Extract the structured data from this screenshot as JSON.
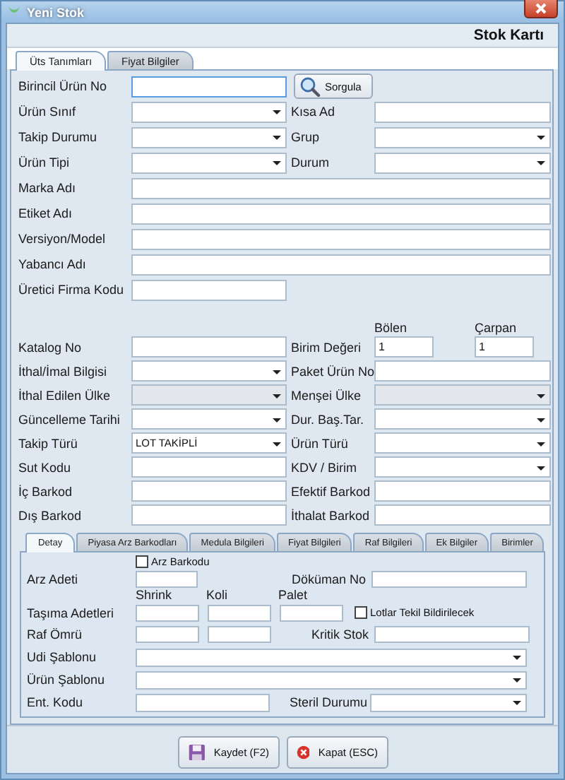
{
  "window": {
    "title": "Yeni Stok"
  },
  "header": {
    "title": "Stok Kartı"
  },
  "tabs": [
    {
      "label": "Üts Tanımları",
      "selected": true
    },
    {
      "label": "Fiyat Bilgiler",
      "selected": false
    }
  ],
  "form": {
    "search_button": "Sorgula",
    "rows": [
      {
        "kind": "search",
        "fields": [
          {
            "label": "Birincil Ürün No",
            "kind": "text",
            "disabled": false
          }
        ]
      },
      {
        "kind": "pair",
        "fields": [
          {
            "label": "Ürün Sınıf",
            "kind": "select",
            "disabled": false
          },
          {
            "label": "Kısa Ad",
            "kind": "text",
            "disabled": false
          }
        ]
      },
      {
        "kind": "pair",
        "fields": [
          {
            "label": "Takip Durumu",
            "kind": "select",
            "disabled": false
          },
          {
            "label": "Grup",
            "kind": "select",
            "disabled": false
          }
        ]
      },
      {
        "kind": "pair",
        "fields": [
          {
            "label": "Ürün Tipi",
            "kind": "select",
            "disabled": false
          },
          {
            "label": "Durum",
            "kind": "select",
            "disabled": false
          }
        ]
      },
      {
        "kind": "wide",
        "fields": [
          {
            "label": "Marka Adı",
            "kind": "text",
            "disabled": false
          }
        ]
      },
      {
        "kind": "wide",
        "fields": [
          {
            "label": "Etiket Adı",
            "kind": "text",
            "disabled": false
          }
        ]
      },
      {
        "kind": "wide",
        "fields": [
          {
            "label": "Versiyon/Model",
            "kind": "text",
            "disabled": false
          }
        ]
      },
      {
        "kind": "wide",
        "fields": [
          {
            "label": "Yabancı Adı",
            "kind": "text",
            "disabled": false
          }
        ]
      },
      {
        "kind": "single",
        "fields": [
          {
            "label": "Üretici Firma Kodu",
            "kind": "text",
            "disabled": false
          }
        ]
      },
      {
        "kind": "ratio",
        "fields": [
          {
            "label": "Katalog No",
            "kind": "text",
            "disabled": false
          }
        ],
        "ratio": {
          "label": "Birim Değeri",
          "parts": [
            {
              "heading": "Bölen",
              "value": "1"
            },
            {
              "heading": "Çarpan",
              "value": "1"
            }
          ]
        }
      },
      {
        "kind": "pair",
        "fields": [
          {
            "label": "İthal/İmal Bilgisi",
            "kind": "select",
            "disabled": false
          },
          {
            "label": "Paket Ürün No",
            "kind": "text",
            "disabled": false
          }
        ]
      },
      {
        "kind": "pair",
        "fields": [
          {
            "label": "İthal Edilen Ülke",
            "kind": "select",
            "disabled": true
          },
          {
            "label": "Menşei Ülke",
            "kind": "select",
            "disabled": true
          }
        ]
      },
      {
        "kind": "pair",
        "fields": [
          {
            "label": "Güncelleme Tarihi",
            "kind": "select",
            "disabled": false
          },
          {
            "label": "Dur. Baş.Tar.",
            "kind": "select",
            "disabled": false
          }
        ]
      },
      {
        "kind": "pair",
        "fields": [
          {
            "label": "Takip Türü",
            "kind": "select",
            "value": "LOT TAKİPLİ",
            "disabled": false
          },
          {
            "label": "Ürün Türü",
            "kind": "select",
            "disabled": false
          }
        ]
      },
      {
        "kind": "pair",
        "fields": [
          {
            "label": "Sut Kodu",
            "kind": "text",
            "disabled": false
          },
          {
            "label": "KDV / Birim",
            "kind": "select",
            "disabled": false
          }
        ]
      },
      {
        "kind": "pair",
        "fields": [
          {
            "label": "İç Barkod",
            "kind": "text",
            "disabled": false
          },
          {
            "label": "Efektif Barkod",
            "kind": "text",
            "disabled": false
          }
        ]
      },
      {
        "kind": "pair",
        "fields": [
          {
            "label": "Dış Barkod",
            "kind": "text",
            "disabled": false
          },
          {
            "label": "İthalat Barkod",
            "kind": "text",
            "disabled": false
          }
        ]
      }
    ]
  },
  "detail_tabs": [
    {
      "label": "Detay",
      "selected": true
    },
    {
      "label": "Piyasa Arz Barkodları",
      "selected": false
    },
    {
      "label": "Medula Bilgileri",
      "selected": false
    },
    {
      "label": "Fiyat Bilgileri",
      "selected": false
    },
    {
      "label": "Raf Bilgileri",
      "selected": false
    },
    {
      "label": "Ek Bilgiler",
      "selected": false
    },
    {
      "label": "Birimler",
      "selected": false
    }
  ],
  "detail": {
    "rows": [
      {
        "kind": "checkbox",
        "label": "Arz Barkodu",
        "checked": false
      },
      {
        "kind": "short_pair",
        "fields": [
          {
            "label": "Arz Adeti",
            "kind": "text"
          },
          {
            "label": "Döküman No",
            "kind": "text"
          }
        ]
      },
      {
        "kind": "counts",
        "label": "Taşıma Adetleri",
        "headings": [
          "Shrink",
          "Koli",
          "Palet"
        ],
        "option": {
          "label": "Lotlar Tekil Bildirilecek",
          "checked": false
        }
      },
      {
        "kind": "twin",
        "label": "Raf Ömrü",
        "right": {
          "label": "Kritik Stok",
          "kind": "text"
        }
      },
      {
        "kind": "wide",
        "fields": [
          {
            "label": "Udi Şablonu",
            "kind": "select"
          }
        ]
      },
      {
        "kind": "wide",
        "fields": [
          {
            "label": "Ürün Şablonu",
            "kind": "select"
          }
        ]
      },
      {
        "kind": "pair",
        "fields": [
          {
            "label": "Ent. Kodu",
            "kind": "text"
          },
          {
            "label": "Steril Durumu",
            "kind": "select"
          }
        ]
      }
    ]
  },
  "buttons": [
    {
      "kind": "save",
      "label": "Kaydet (F2)"
    },
    {
      "kind": "close",
      "label": "Kapat (ESC)"
    }
  ]
}
